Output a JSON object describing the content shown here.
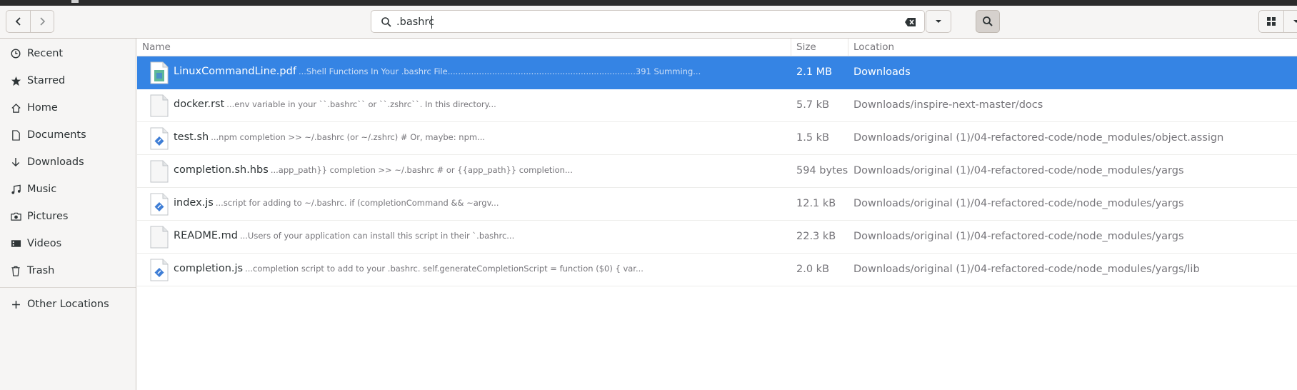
{
  "search": {
    "query": ".bashrc"
  },
  "columns": {
    "name": "Name",
    "size": "Size",
    "location": "Location"
  },
  "sidebar": {
    "items": [
      {
        "label": "Recent",
        "icon": "clock-icon"
      },
      {
        "label": "Starred",
        "icon": "star-icon"
      },
      {
        "label": "Home",
        "icon": "home-icon"
      },
      {
        "label": "Documents",
        "icon": "document-icon"
      },
      {
        "label": "Downloads",
        "icon": "download-icon"
      },
      {
        "label": "Music",
        "icon": "music-icon"
      },
      {
        "label": "Pictures",
        "icon": "camera-icon"
      },
      {
        "label": "Videos",
        "icon": "video-icon"
      },
      {
        "label": "Trash",
        "icon": "trash-icon"
      }
    ],
    "other": {
      "label": "Other Locations",
      "icon": "plus-icon"
    }
  },
  "files": [
    {
      "name": "LinuxCommandLine.pdf",
      "snippet": "...Shell Functions In Your .bashrc File........................................................................391 Summing...",
      "size": "2.1 MB",
      "location": "Downloads",
      "icon": "pdf-file-icon",
      "selected": true
    },
    {
      "name": "docker.rst",
      "snippet": "...env variable in your ``.bashrc`` or ``.zshrc``. In this directory...",
      "size": "5.7 kB",
      "location": "Downloads/inspire-next-master/docs",
      "icon": "text-file-icon"
    },
    {
      "name": "test.sh",
      "snippet": "...npm completion >> ~/.bashrc  (or ~/.zshrc) # Or, maybe: npm...",
      "size": "1.5 kB",
      "location": "Downloads/original (1)/04-refactored-code/node_modules/object.assign",
      "icon": "script-file-icon"
    },
    {
      "name": "completion.sh.hbs",
      "snippet": "...app_path}} completion >> ~/.bashrc #   or {{app_path}} completion...",
      "size": "594 bytes",
      "location": "Downloads/original (1)/04-refactored-code/node_modules/yargs",
      "icon": "text-file-icon"
    },
    {
      "name": "index.js",
      "snippet": "...script for adding to ~/.bashrc.    if (completionCommand && ~argv...",
      "size": "12.1 kB",
      "location": "Downloads/original (1)/04-refactored-code/node_modules/yargs",
      "icon": "script-file-icon"
    },
    {
      "name": "README.md",
      "snippet": "...Users of your application can install this script in their `.bashrc...",
      "size": "22.3 kB",
      "location": "Downloads/original (1)/04-refactored-code/node_modules/yargs",
      "icon": "text-file-icon"
    },
    {
      "name": "completion.js",
      "snippet": "...completion script to add to your .bashrc.   self.generateCompletionScript = function ($0) {    var...",
      "size": "2.0 kB",
      "location": "Downloads/original (1)/04-refactored-code/node_modules/yargs/lib",
      "icon": "script-file-icon"
    }
  ],
  "colors": {
    "selection": "#3584e4",
    "sidebar_bg": "#f6f5f4",
    "header_bg": "#f6f5f4"
  }
}
